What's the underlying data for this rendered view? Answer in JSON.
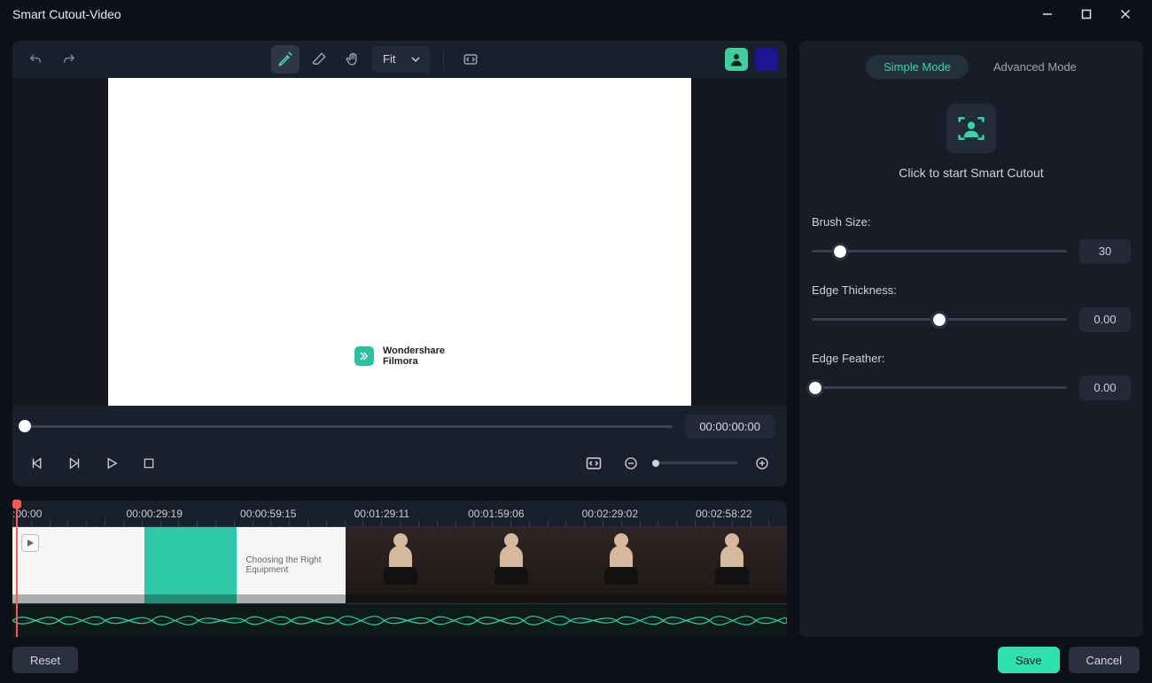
{
  "title": "Smart Cutout-Video",
  "toolbar": {
    "zoom_label": "Fit"
  },
  "watermark": {
    "line1": "Wondershare",
    "line2": "Filmora"
  },
  "timecode": "00:00:00:00",
  "ruler_marks": [
    ":00:00",
    "00:00:29:19",
    "00:00:59:15",
    "00:01:29:11",
    "00:01:59:06",
    "00:02:29:02",
    "00:02:58:22"
  ],
  "clip_caption": "Choosing the Right Equipment",
  "right_panel": {
    "simple_mode": "Simple Mode",
    "advanced_mode": "Advanced Mode",
    "start_text": "Click to start Smart Cutout",
    "brush_label": "Brush Size:",
    "brush_value": "30",
    "brush_pos_pct": 11,
    "edge_thickness_label": "Edge Thickness:",
    "edge_thickness_value": "0.00",
    "edge_thickness_pos_pct": 50,
    "edge_feather_label": "Edge Feather:",
    "edge_feather_value": "0.00",
    "edge_feather_pos_pct": 1.5
  },
  "footer": {
    "reset": "Reset",
    "save": "Save",
    "cancel": "Cancel"
  }
}
